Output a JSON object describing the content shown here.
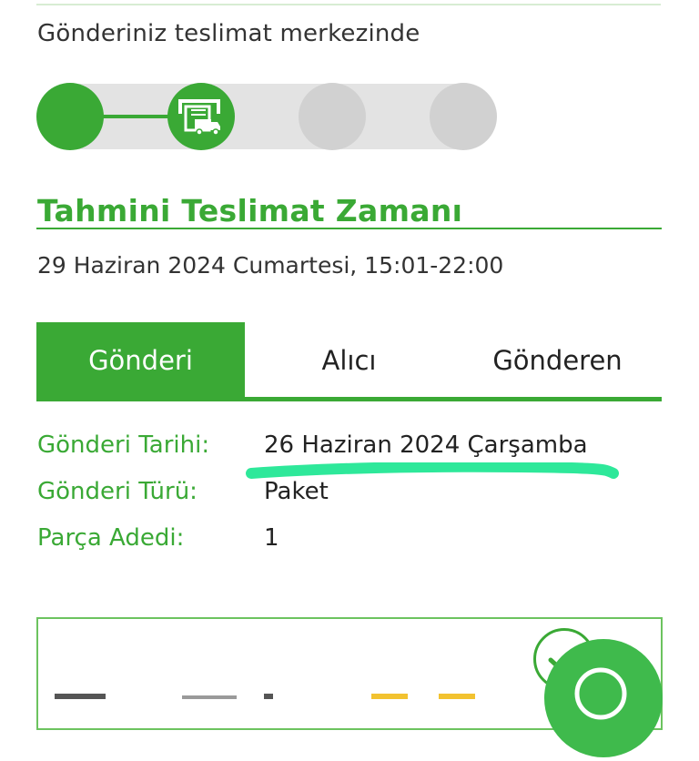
{
  "status": {
    "text": "Gönderiniz teslimat merkezinde"
  },
  "tracker": {
    "steps": [
      {
        "state": "done",
        "icon": "circle"
      },
      {
        "state": "done",
        "icon": "truck-warehouse-icon"
      },
      {
        "state": "pending",
        "icon": "circle"
      },
      {
        "state": "pending",
        "icon": "circle"
      }
    ],
    "current_step": 2,
    "total_steps": 4
  },
  "eta": {
    "title": "Tahmini Teslimat Zamanı",
    "value": "29 Haziran 2024 Cumartesi, 15:01-22:00"
  },
  "tabs": [
    {
      "label": "Gönderi",
      "active": true
    },
    {
      "label": "Alıcı",
      "active": false
    },
    {
      "label": "Gönderen",
      "active": false
    }
  ],
  "details": [
    {
      "label": "Gönderi Tarihi:",
      "value": "26 Haziran 2024 Çarşamba"
    },
    {
      "label": "Gönderi Türü:",
      "value": "Paket"
    },
    {
      "label": "Parça Adedi:",
      "value": "1"
    }
  ],
  "colors": {
    "brand_green": "#3aa935",
    "pending_gray": "#d1d1d1",
    "track_gray": "#e3e3e3",
    "highlight_mint": "#2ee89a",
    "fab_green": "#3fba4c"
  }
}
